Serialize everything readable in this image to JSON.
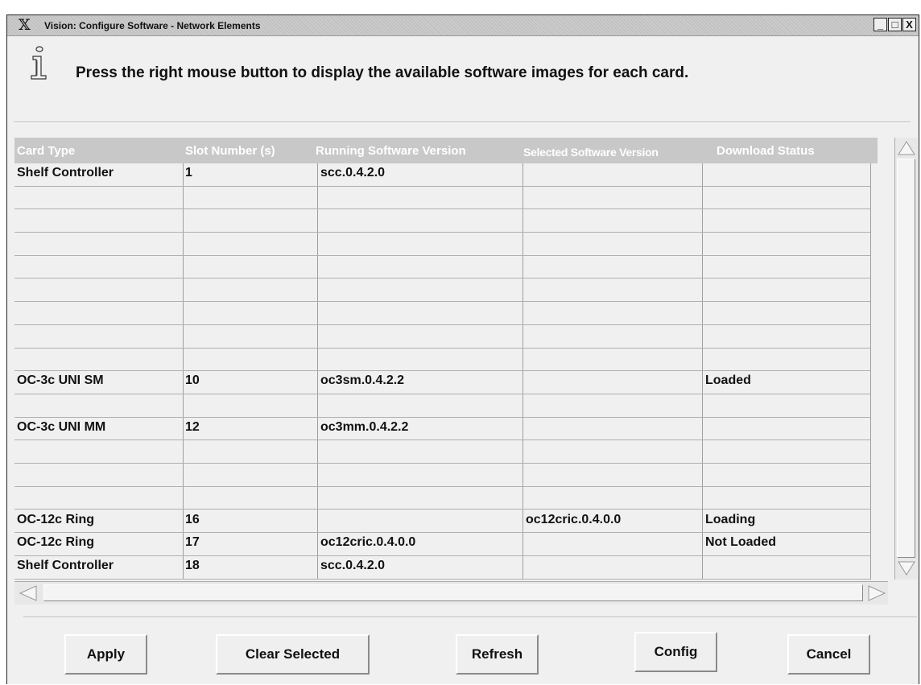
{
  "window": {
    "title": "Vision: Configure Software -  Network Elements",
    "controls": {
      "minimize": "_",
      "maximize": "□",
      "close": "X"
    }
  },
  "info": {
    "icon": "info-icon",
    "message": "Press the right mouse button to display the available software images for each card."
  },
  "table": {
    "columns": [
      "Card Type",
      "Slot Number (s)",
      "Running Software Version",
      "Selected Software Version",
      "Download Status"
    ],
    "rows": [
      [
        "Shelf Controller",
        "1",
        "scc.0.4.2.0",
        "",
        ""
      ],
      [
        "",
        "",
        "",
        "",
        ""
      ],
      [
        "",
        "",
        "",
        "",
        ""
      ],
      [
        "",
        "",
        "",
        "",
        ""
      ],
      [
        "",
        "",
        "",
        "",
        ""
      ],
      [
        "",
        "",
        "",
        "",
        ""
      ],
      [
        "",
        "",
        "",
        "",
        ""
      ],
      [
        "",
        "",
        "",
        "",
        ""
      ],
      [
        "",
        "",
        "",
        "",
        ""
      ],
      [
        "OC-3c UNI SM",
        "10",
        "oc3sm.0.4.2.2",
        "",
        "Loaded"
      ],
      [
        "",
        "",
        "",
        "",
        ""
      ],
      [
        "OC-3c UNI MM",
        "12",
        "oc3mm.0.4.2.2",
        "",
        ""
      ],
      [
        "",
        "",
        "",
        "",
        ""
      ],
      [
        "",
        "",
        "",
        "",
        ""
      ],
      [
        "",
        "",
        "",
        "",
        ""
      ],
      [
        "OC-12c Ring",
        "16",
        "",
        "oc12cric.0.4.0.0",
        "Loading"
      ],
      [
        "OC-12c Ring",
        "17",
        "oc12cric.0.4.0.0",
        "",
        "Not Loaded"
      ],
      [
        "Shelf Controller",
        "18",
        "scc.0.4.2.0",
        "",
        ""
      ]
    ]
  },
  "buttons": {
    "apply": "Apply",
    "clear_selected": "Clear Selected",
    "refresh": "Refresh",
    "config": "Config",
    "cancel": "Cancel"
  }
}
